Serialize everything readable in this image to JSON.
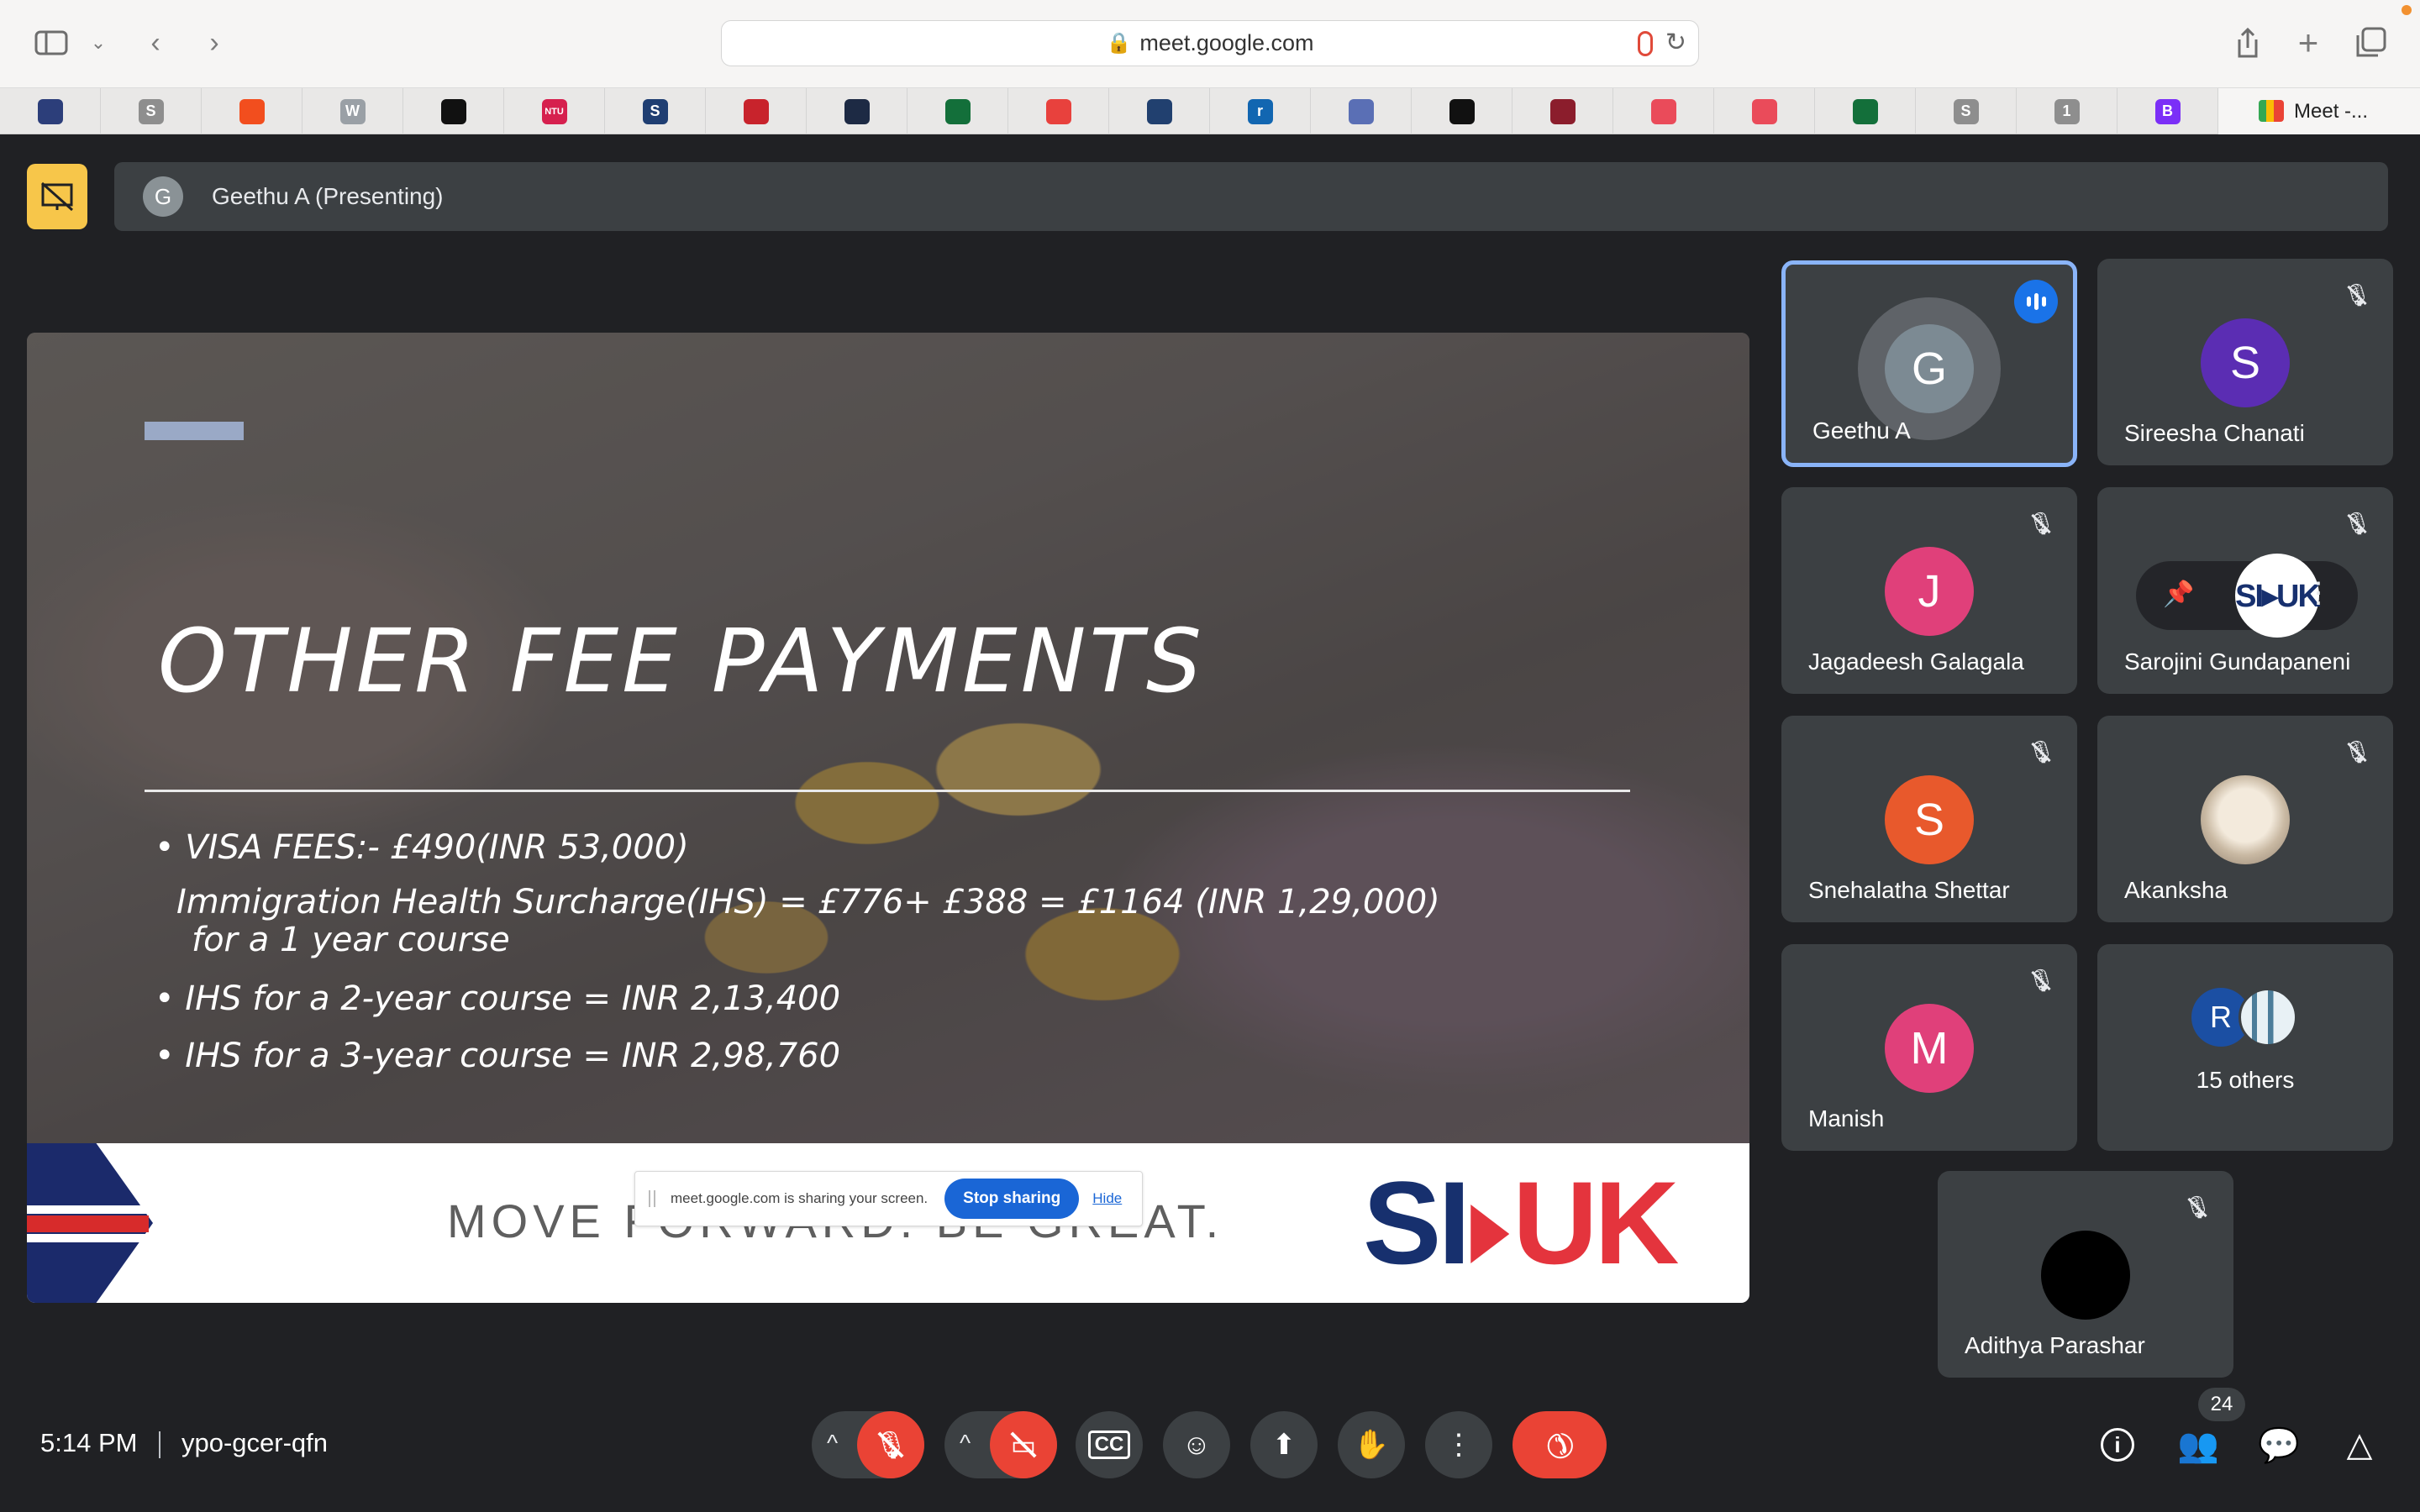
{
  "browser": {
    "url": "meet.google.com",
    "active_tab_label": "Meet -...",
    "favorites": [
      {
        "icon": "crest-icon",
        "letter": "",
        "color": "#2c3e7a"
      },
      {
        "icon": "s-icon",
        "letter": "S",
        "color": "#8e8e8e"
      },
      {
        "icon": "figma-icon",
        "letter": "",
        "color": "#f24e1e"
      },
      {
        "icon": "w-icon",
        "letter": "W",
        "color": "#9aa0a6"
      },
      {
        "icon": "shield-icon",
        "letter": "",
        "color": "#111111"
      },
      {
        "icon": "ntu-icon",
        "letter": "NTU",
        "color": "#d6204e"
      },
      {
        "icon": "s-icon",
        "letter": "S",
        "color": "#1f3e72"
      },
      {
        "icon": "crest-icon",
        "letter": "",
        "color": "#c8232c"
      },
      {
        "icon": "circle-logo-icon",
        "letter": "",
        "color": "#1d2a44"
      },
      {
        "icon": "crest-icon",
        "letter": "",
        "color": "#136f3a"
      },
      {
        "icon": "flag-icon",
        "letter": "",
        "color": "#e8413d"
      },
      {
        "icon": "crest-icon",
        "letter": "",
        "color": "#21406f"
      },
      {
        "icon": "r-icon",
        "letter": "r",
        "color": "#1266b1"
      },
      {
        "icon": "crown-icon",
        "letter": "",
        "color": "#5a6fb5"
      },
      {
        "icon": "shield-icon",
        "letter": "",
        "color": "#111111"
      },
      {
        "icon": "crest-icon",
        "letter": "",
        "color": "#8b1d2c"
      },
      {
        "icon": "swirl-icon",
        "letter": "",
        "color": "#ea4b5a"
      },
      {
        "icon": "swirl-icon",
        "letter": "",
        "color": "#ea4b5a"
      },
      {
        "icon": "crest-icon",
        "letter": "",
        "color": "#136f3a"
      },
      {
        "icon": "s-icon",
        "letter": "S",
        "color": "#8e8e8e"
      },
      {
        "icon": "one-icon",
        "letter": "1",
        "color": "#8e8e8e"
      },
      {
        "icon": "bootstrap-icon",
        "letter": "B",
        "color": "#7b2ff7"
      }
    ]
  },
  "meet": {
    "presenter_initial": "G",
    "presenter_label": "Geethu A (Presenting)",
    "slide": {
      "title": "OTHER FEE PAYMENTS",
      "lines": [
        "• VISA FEES:- £490(INR 53,000)",
        "Immigration Health Surcharge(IHS) = £776+ £388 = £1164 (INR 1,29,000)",
        "for a 1 year course",
        "• IHS for a 2-year course = INR 2,13,400",
        "• IHS for a 3-year course = INR 2,98,760"
      ],
      "tagline": "MOVE FORWARD. BE GREAT.",
      "logo_left": "SI",
      "logo_right": "UK"
    },
    "share_banner": {
      "text": "meet.google.com is sharing your screen.",
      "stop_label": "Stop sharing",
      "hide_label": "Hide"
    },
    "participants": [
      {
        "name": "Geethu A",
        "initial": "G",
        "color": "#7c8a93"
      },
      {
        "name": "Sireesha Chanati",
        "initial": "S",
        "color": "#5b2db3"
      },
      {
        "name": "Jagadeesh Galagala",
        "initial": "J",
        "color": "#e0407a"
      },
      {
        "name": "Sarojini Gundapaneni",
        "initial": "SI▸UK",
        "color": "#ffffff"
      },
      {
        "name": "Snehalatha Shettar",
        "initial": "S",
        "color": "#e8592c"
      },
      {
        "name": "Akanksha",
        "initial": "",
        "color": "#d8cbb8"
      },
      {
        "name": "Manish",
        "initial": "M",
        "color": "#e0407a"
      },
      {
        "name": "Adithya Parashar",
        "initial": "",
        "color": "#000000"
      }
    ],
    "others": {
      "initial": "R",
      "label": "15 others"
    },
    "bottom": {
      "time": "5:14 PM",
      "meeting_code": "ypo-gcer-qfn",
      "people_count": "24"
    }
  }
}
